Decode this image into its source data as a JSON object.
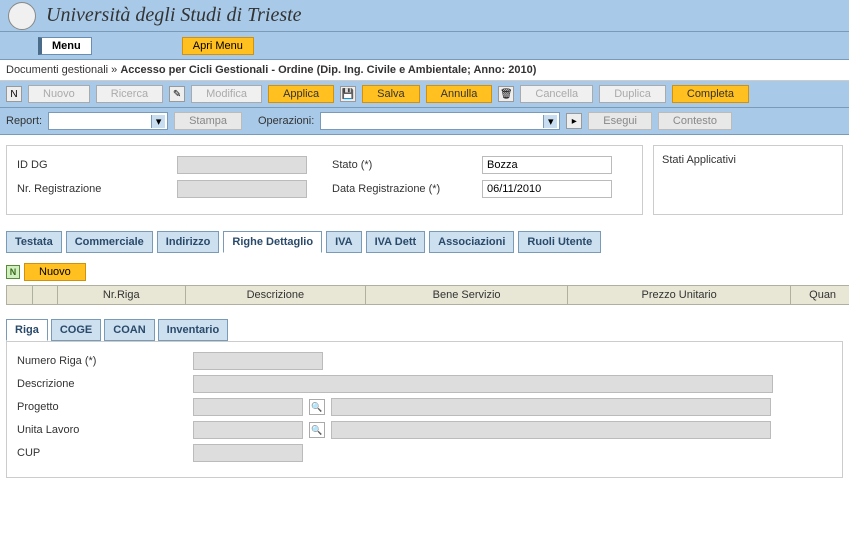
{
  "header": {
    "title": "Università degli Studi di Trieste"
  },
  "menu": {
    "main": "Menu",
    "apri": "Apri Menu"
  },
  "breadcrumb": {
    "prefix": "Documenti gestionali » ",
    "bold": "Accesso per Cicli Gestionali - Ordine (Dip. Ing. Civile e Ambientale; Anno: 2010)"
  },
  "toolbar": {
    "nuovo": "Nuovo",
    "ricerca": "Ricerca",
    "modifica": "Modifica",
    "applica": "Applica",
    "salva": "Salva",
    "annulla": "Annulla",
    "cancella": "Cancella",
    "duplica": "Duplica",
    "completa": "Completa"
  },
  "toolbar2": {
    "report_label": "Report:",
    "stampa": "Stampa",
    "operazioni_label": "Operazioni:",
    "esegui": "Esegui",
    "contesto": "Contesto"
  },
  "form": {
    "id_dg_label": "ID DG",
    "id_dg_val": "",
    "stato_label": "Stato (*)",
    "stato_val": "Bozza",
    "nrreg_label": "Nr. Registrazione",
    "nrreg_val": "",
    "datareg_label": "Data Registrazione (*)",
    "datareg_val": "06/11/2010",
    "stati_app": "Stati Applicativi"
  },
  "tabs": {
    "testata": "Testata",
    "commerciale": "Commerciale",
    "indirizzo": "Indirizzo",
    "righe": "Righe Dettaglio",
    "iva": "IVA",
    "ivadett": "IVA Dett",
    "associazioni": "Associazioni",
    "ruoli": "Ruoli Utente"
  },
  "grid": {
    "nuovo": "Nuovo",
    "cols": {
      "nrriga": "Nr.Riga",
      "descr": "Descrizione",
      "bene": "Bene Servizio",
      "prezzo": "Prezzo Unitario",
      "quan": "Quan"
    }
  },
  "subtabs": {
    "riga": "Riga",
    "coge": "COGE",
    "coan": "COAN",
    "inv": "Inventario"
  },
  "detail": {
    "numero_riga": "Numero Riga (*)",
    "descrizione": "Descrizione",
    "progetto": "Progetto",
    "unita_lavoro": "Unita Lavoro",
    "cup": "CUP"
  }
}
